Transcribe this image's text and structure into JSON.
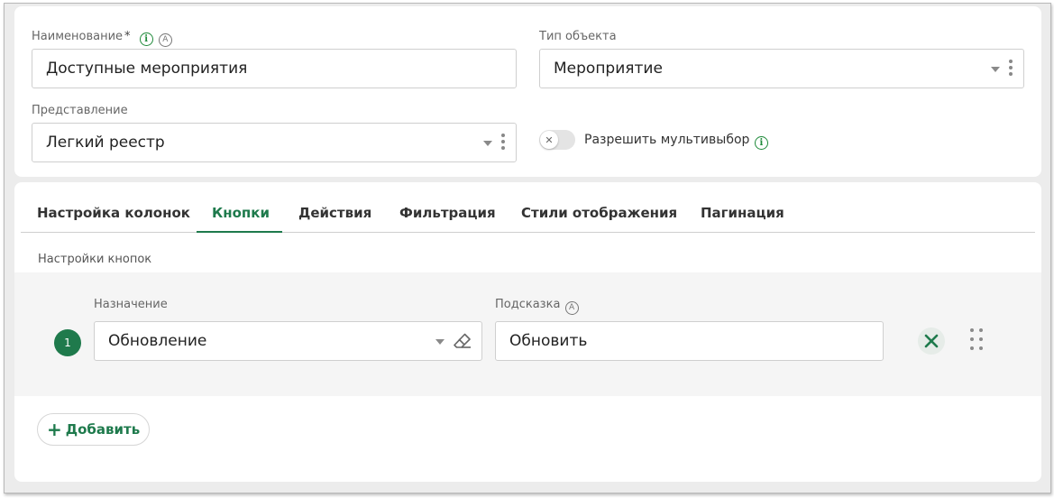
{
  "top": {
    "name_label": "Наименование",
    "required_mark": "*",
    "name_value": "Доступные мероприятия",
    "type_label": "Тип объекта",
    "type_value": "Мероприятие",
    "view_label": "Представление",
    "view_value": "Легкий реестр",
    "multiselect_label": "Разрешить мультивыбор",
    "multiselect_enabled": false
  },
  "tabs": [
    {
      "label": "Настройка колонок",
      "active": false
    },
    {
      "label": "Кнопки",
      "active": true
    },
    {
      "label": "Действия",
      "active": false
    },
    {
      "label": "Фильтрация",
      "active": false
    },
    {
      "label": "Стили отображения",
      "active": false
    },
    {
      "label": "Пагинация",
      "active": false
    }
  ],
  "buttons_section": {
    "title": "Настройки кнопок",
    "rows": [
      {
        "number": "1",
        "purpose_label": "Назначение",
        "purpose_value": "Обновление",
        "hint_label": "Подсказка",
        "hint_value": "Обновить"
      }
    ],
    "add_label": "Добавить"
  },
  "icons": {
    "info": "info-circle-icon",
    "auto": "auto-a-icon",
    "dropdown": "chevron-down-icon",
    "more": "more-vertical-icon",
    "clear": "eraser-icon",
    "remove": "close-icon",
    "drag": "drag-handle-icon",
    "add": "plus-icon"
  },
  "colors": {
    "accent": "#1e7a4c",
    "info": "#1f8a3a"
  }
}
